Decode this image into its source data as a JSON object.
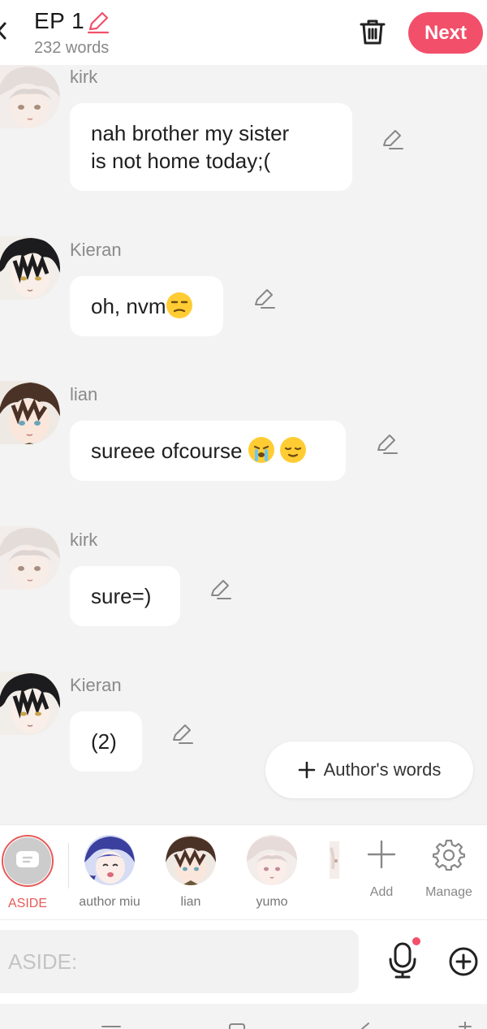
{
  "header": {
    "title": "EP 1",
    "word_count": "232 words",
    "next_label": "Next"
  },
  "messages": [
    {
      "speaker": "kirk",
      "text_line1": "nah brother my sister",
      "text_line2": "is not home today;("
    },
    {
      "speaker": "Kieran",
      "text": "oh, nvm"
    },
    {
      "speaker": "lian",
      "text": "sureee ofcourse "
    },
    {
      "speaker": "kirk",
      "text": "sure=)"
    },
    {
      "speaker": "Kieran",
      "text": "(2)"
    }
  ],
  "author_words_label": "Author's words",
  "characters": [
    {
      "name": "ASIDE"
    },
    {
      "name": "author miu"
    },
    {
      "name": "lian"
    },
    {
      "name": "yumo"
    }
  ],
  "tools": {
    "add_label": "Add",
    "manage_label": "Manage"
  },
  "input": {
    "placeholder": "ASIDE:"
  },
  "colors": {
    "accent": "#f24f6a",
    "aside_ring": "#e65a5a",
    "background": "#f3f3f3"
  }
}
